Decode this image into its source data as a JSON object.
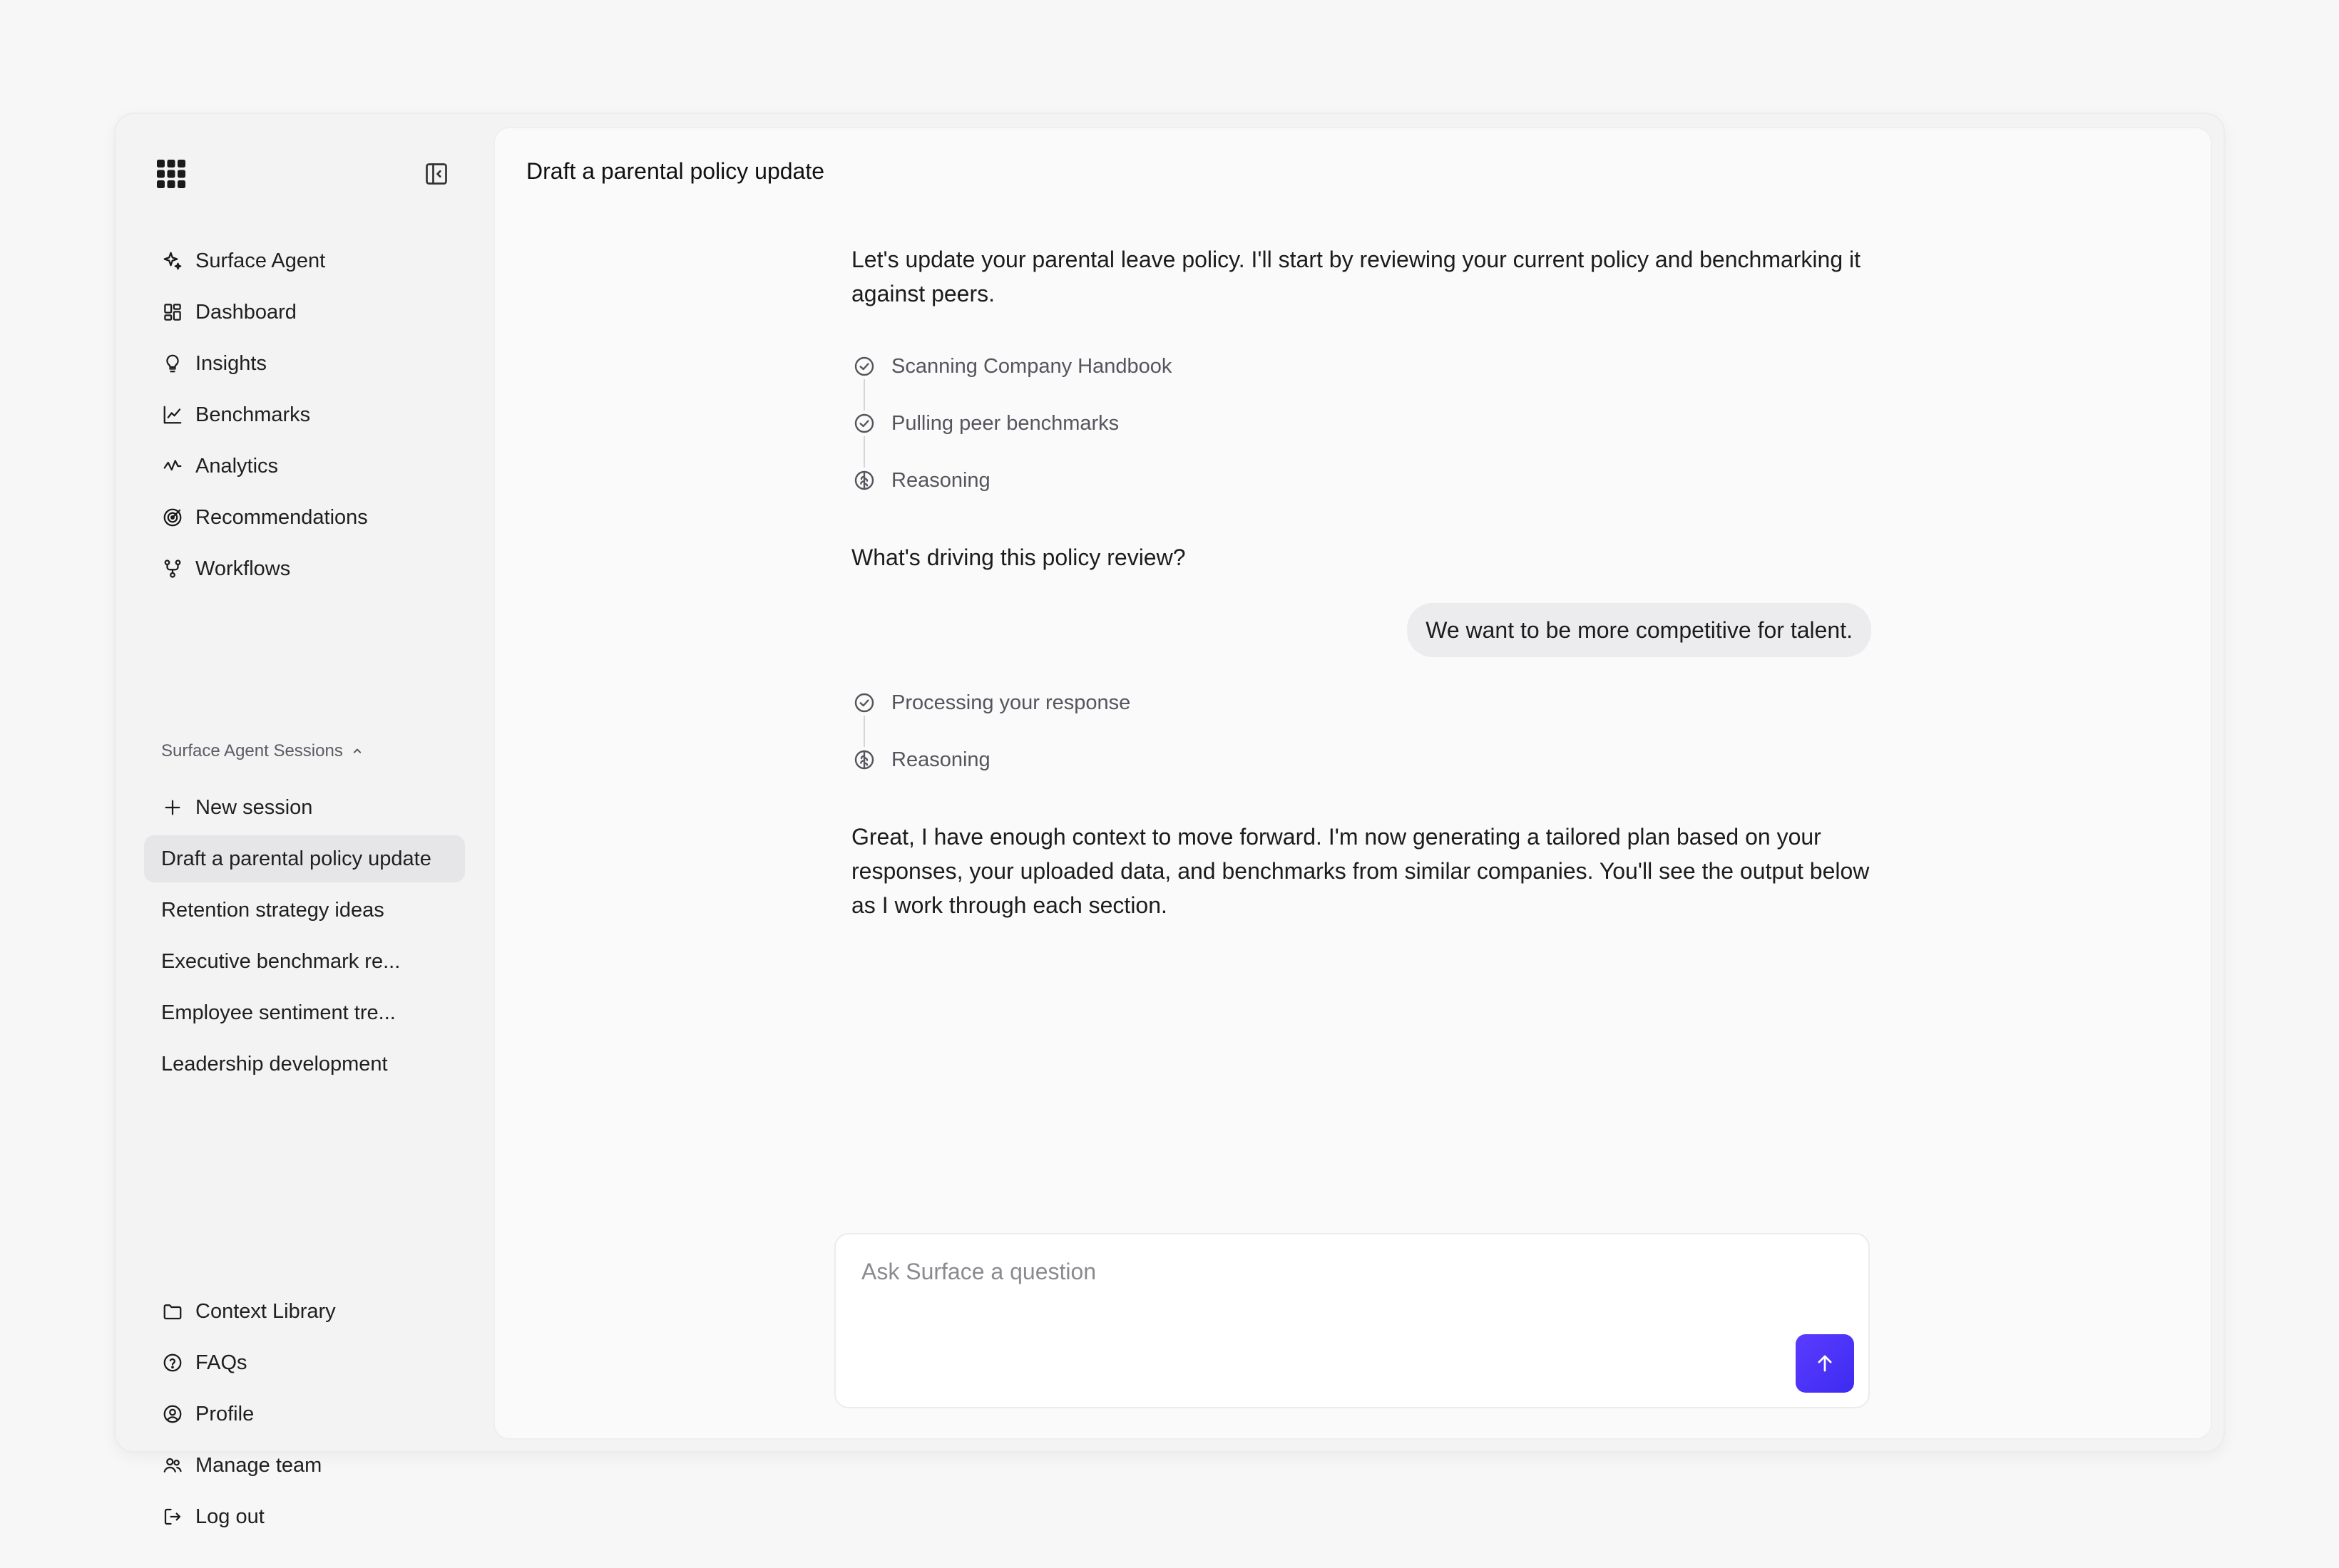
{
  "sidebar": {
    "nav": [
      {
        "label": "Surface Agent",
        "icon": "sparkle-icon"
      },
      {
        "label": "Dashboard",
        "icon": "dashboard-icon"
      },
      {
        "label": "Insights",
        "icon": "lightbulb-icon"
      },
      {
        "label": "Benchmarks",
        "icon": "chart-up-icon"
      },
      {
        "label": "Analytics",
        "icon": "activity-icon"
      },
      {
        "label": "Recommendations",
        "icon": "target-icon"
      },
      {
        "label": "Workflows",
        "icon": "workflow-icon"
      }
    ],
    "sessions_header": "Surface Agent Sessions",
    "new_session": "New session",
    "sessions": [
      "Draft a parental policy update",
      "Retention strategy ideas",
      "Executive benchmark re...",
      "Employee sentiment tre...",
      "Leadership development"
    ],
    "bottom": [
      {
        "label": "Context Library",
        "icon": "folder-icon"
      },
      {
        "label": "FAQs",
        "icon": "help-circle-icon"
      },
      {
        "label": "Profile",
        "icon": "user-circle-icon"
      },
      {
        "label": "Manage team",
        "icon": "users-icon"
      },
      {
        "label": "Log out",
        "icon": "logout-icon"
      }
    ]
  },
  "main": {
    "title": "Draft a parental policy update",
    "messages": {
      "intro": "Let's update your parental leave policy. I'll start by reviewing your current policy and benchmarking it against peers.",
      "steps1": [
        "Scanning Company Handbook",
        "Pulling peer benchmarks",
        "Reasoning"
      ],
      "question": "What's driving this policy review?",
      "user_reply": "We want to be more competitive for talent.",
      "steps2": [
        "Processing your response",
        "Reasoning"
      ],
      "final": "Great, I have enough context to move forward. I'm now generating a tailored plan based on your responses, your uploaded data, and benchmarks from similar companies. You'll see the output below as I work through each section."
    },
    "composer": {
      "placeholder": "Ask Surface a question"
    }
  },
  "colors": {
    "accent": "#4b33f5",
    "active_session_bg": "#e6e6e9"
  }
}
